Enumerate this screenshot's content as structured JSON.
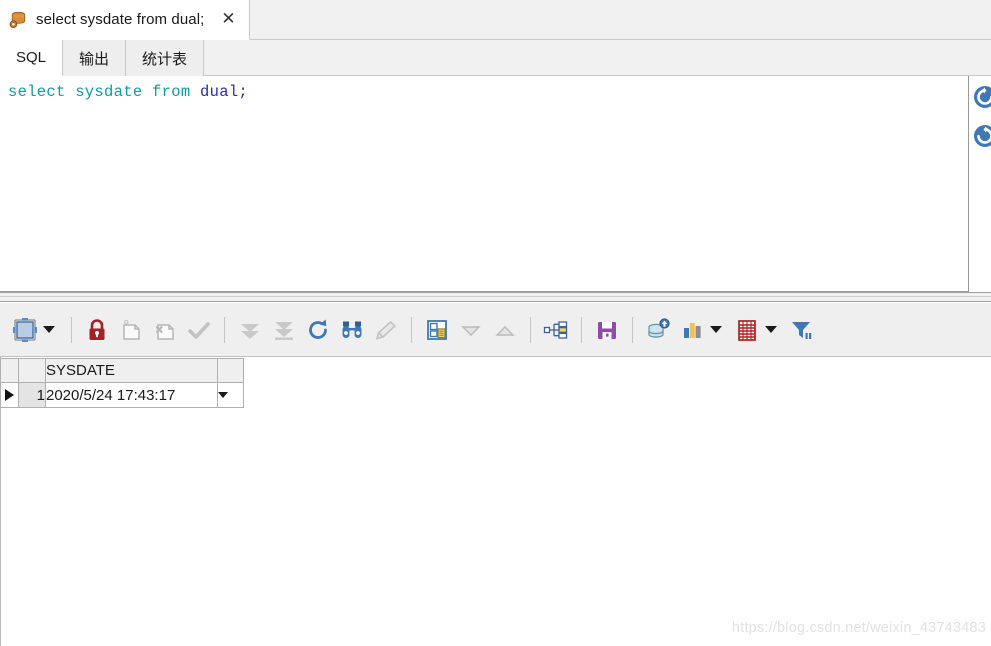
{
  "window": {
    "doc_tab": {
      "icon": "database-gear-icon",
      "title": "select sysdate from dual;",
      "close_label": "✕"
    }
  },
  "subtabs": [
    {
      "label": "SQL",
      "active": true
    },
    {
      "label": "输出",
      "active": false
    },
    {
      "label": "统计表",
      "active": false
    }
  ],
  "editor": {
    "tokens": [
      {
        "text": "select sysdate from ",
        "kind": "keyword"
      },
      {
        "text": "dual;",
        "kind": "object"
      }
    ],
    "full_text": "select sysdate from dual;"
  },
  "side_buttons": [
    {
      "name": "rollback-circle-icon"
    },
    {
      "name": "commit-circle-icon"
    }
  ],
  "result_toolbar": {
    "items": [
      {
        "name": "grid-layout-icon",
        "kind": "icon"
      },
      {
        "name": "grid-layout-dropdown",
        "kind": "caret"
      },
      {
        "name": "separator-1",
        "kind": "separator"
      },
      {
        "name": "lock-icon",
        "kind": "icon"
      },
      {
        "name": "new-record-icon",
        "kind": "icon",
        "disabled": true
      },
      {
        "name": "delete-record-icon",
        "kind": "icon",
        "disabled": true
      },
      {
        "name": "post-changes-icon",
        "kind": "icon",
        "disabled": true
      },
      {
        "name": "separator-2",
        "kind": "separator"
      },
      {
        "name": "fetch-next-page-icon",
        "kind": "icon",
        "disabled": true
      },
      {
        "name": "fetch-last-page-icon",
        "kind": "icon",
        "disabled": true
      },
      {
        "name": "refresh-icon",
        "kind": "icon"
      },
      {
        "name": "find-icon",
        "kind": "icon"
      },
      {
        "name": "clear-filter-icon",
        "kind": "icon",
        "disabled": true
      },
      {
        "name": "separator-3",
        "kind": "separator"
      },
      {
        "name": "single-record-view-icon",
        "kind": "icon"
      },
      {
        "name": "move-down-icon",
        "kind": "icon",
        "disabled": true
      },
      {
        "name": "move-up-icon",
        "kind": "icon",
        "disabled": true
      },
      {
        "name": "separator-4",
        "kind": "separator"
      },
      {
        "name": "export-structure-icon",
        "kind": "icon"
      },
      {
        "name": "separator-5",
        "kind": "separator"
      },
      {
        "name": "save-icon",
        "kind": "icon"
      },
      {
        "name": "separator-6",
        "kind": "separator"
      },
      {
        "name": "upload-to-database-icon",
        "kind": "icon"
      },
      {
        "name": "chart-icon",
        "kind": "icon"
      },
      {
        "name": "chart-dropdown",
        "kind": "caret"
      },
      {
        "name": "table-icon",
        "kind": "icon"
      },
      {
        "name": "table-dropdown",
        "kind": "caret"
      },
      {
        "name": "filter-icon",
        "kind": "icon"
      }
    ]
  },
  "result_grid": {
    "columns": [
      "SYSDATE"
    ],
    "rows": [
      {
        "indicator": "▶",
        "number": "1",
        "values": [
          "2020/5/24 17:43:17"
        ]
      }
    ]
  },
  "watermark": {
    "text": "https://blog.csdn.net/weixin_43743483"
  },
  "colors": {
    "keyword": "#0e9ba3",
    "object": "#2b2bb0",
    "lock_red": "#a52128",
    "save_purple": "#8e4ca8",
    "accent_blue": "#3b76b6",
    "table_red": "#b02020"
  }
}
